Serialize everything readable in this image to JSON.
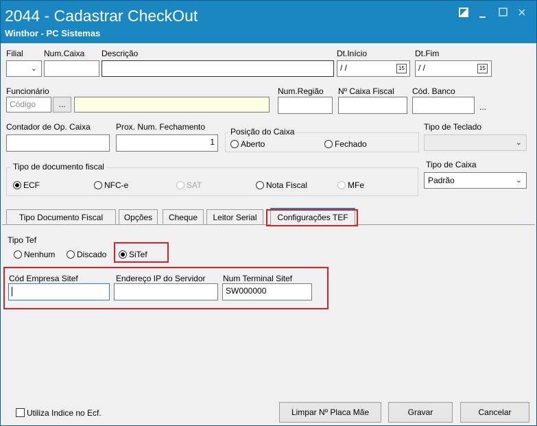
{
  "window": {
    "title": "2044 - Cadastrar CheckOut",
    "subtitle": "Winthor - PC Sistemas",
    "controls": [
      "restore-icon",
      "minimize-icon",
      "maximize-icon",
      "close-icon"
    ]
  },
  "fields": {
    "filial_label": "Filial",
    "num_caixa_label": "Num.Caixa",
    "descricao_label": "Descrição",
    "dt_inicio_label": "Dt.Início",
    "dt_inicio_value": "/ /",
    "dt_fim_label": "Dt.Fim",
    "dt_fim_value": "/ /",
    "funcionario_label": "Funcionário",
    "codigo_placeholder": "Código",
    "lookup_button": "...",
    "num_regiao_label": "Num.Região",
    "num_caixa_fiscal_label": "Nº Caixa Fiscal",
    "cod_banco_label": "Cód. Banco",
    "cod_banco_ellipsis": "...",
    "contador_label": "Contador de Op. Caixa",
    "prox_num_label": "Prox. Num. Fechamento",
    "prox_num_value": "1",
    "posicao_label": "Posição do Caixa",
    "posicao_aberto": "Aberto",
    "posicao_fechado": "Fechado",
    "tipo_teclado_label": "Tipo de Teclado",
    "tipo_doc_label": "Tipo de documento fiscal",
    "doc_options": [
      "ECF",
      "NFC-e",
      "SAT",
      "Nota Fiscal",
      "MFe"
    ],
    "tipo_caixa_label": "Tipo de Caixa",
    "tipo_caixa_value": "Padrão",
    "calendar_glyph": "15"
  },
  "tabs": [
    "Tipo Documento Fiscal",
    "Opções",
    "Cheque",
    "Leitor Serial",
    "Configurações TEF"
  ],
  "tef": {
    "tipo_tef_label": "Tipo Tef",
    "options": [
      "Nenhum",
      "Discado",
      "SiTef"
    ],
    "cod_empresa_label": "Cód Empresa Sitef",
    "cod_empresa_value": "",
    "endereco_ip_label": "Endereço IP do Servidor",
    "endereco_ip_value": "",
    "num_terminal_label": "Num Terminal Sitef",
    "num_terminal_value": "SW000000"
  },
  "footer": {
    "utiliza_indice_label": "Utiliza Indice no Ecf.",
    "limpar_button": "Limpar Nº Placa Mãe",
    "gravar_button": "Gravar",
    "cancelar_button": "Cancelar"
  },
  "colors": {
    "titlebar": "#1a86c2",
    "highlight": "#d1232a",
    "active_tab": "#1a86c2"
  }
}
